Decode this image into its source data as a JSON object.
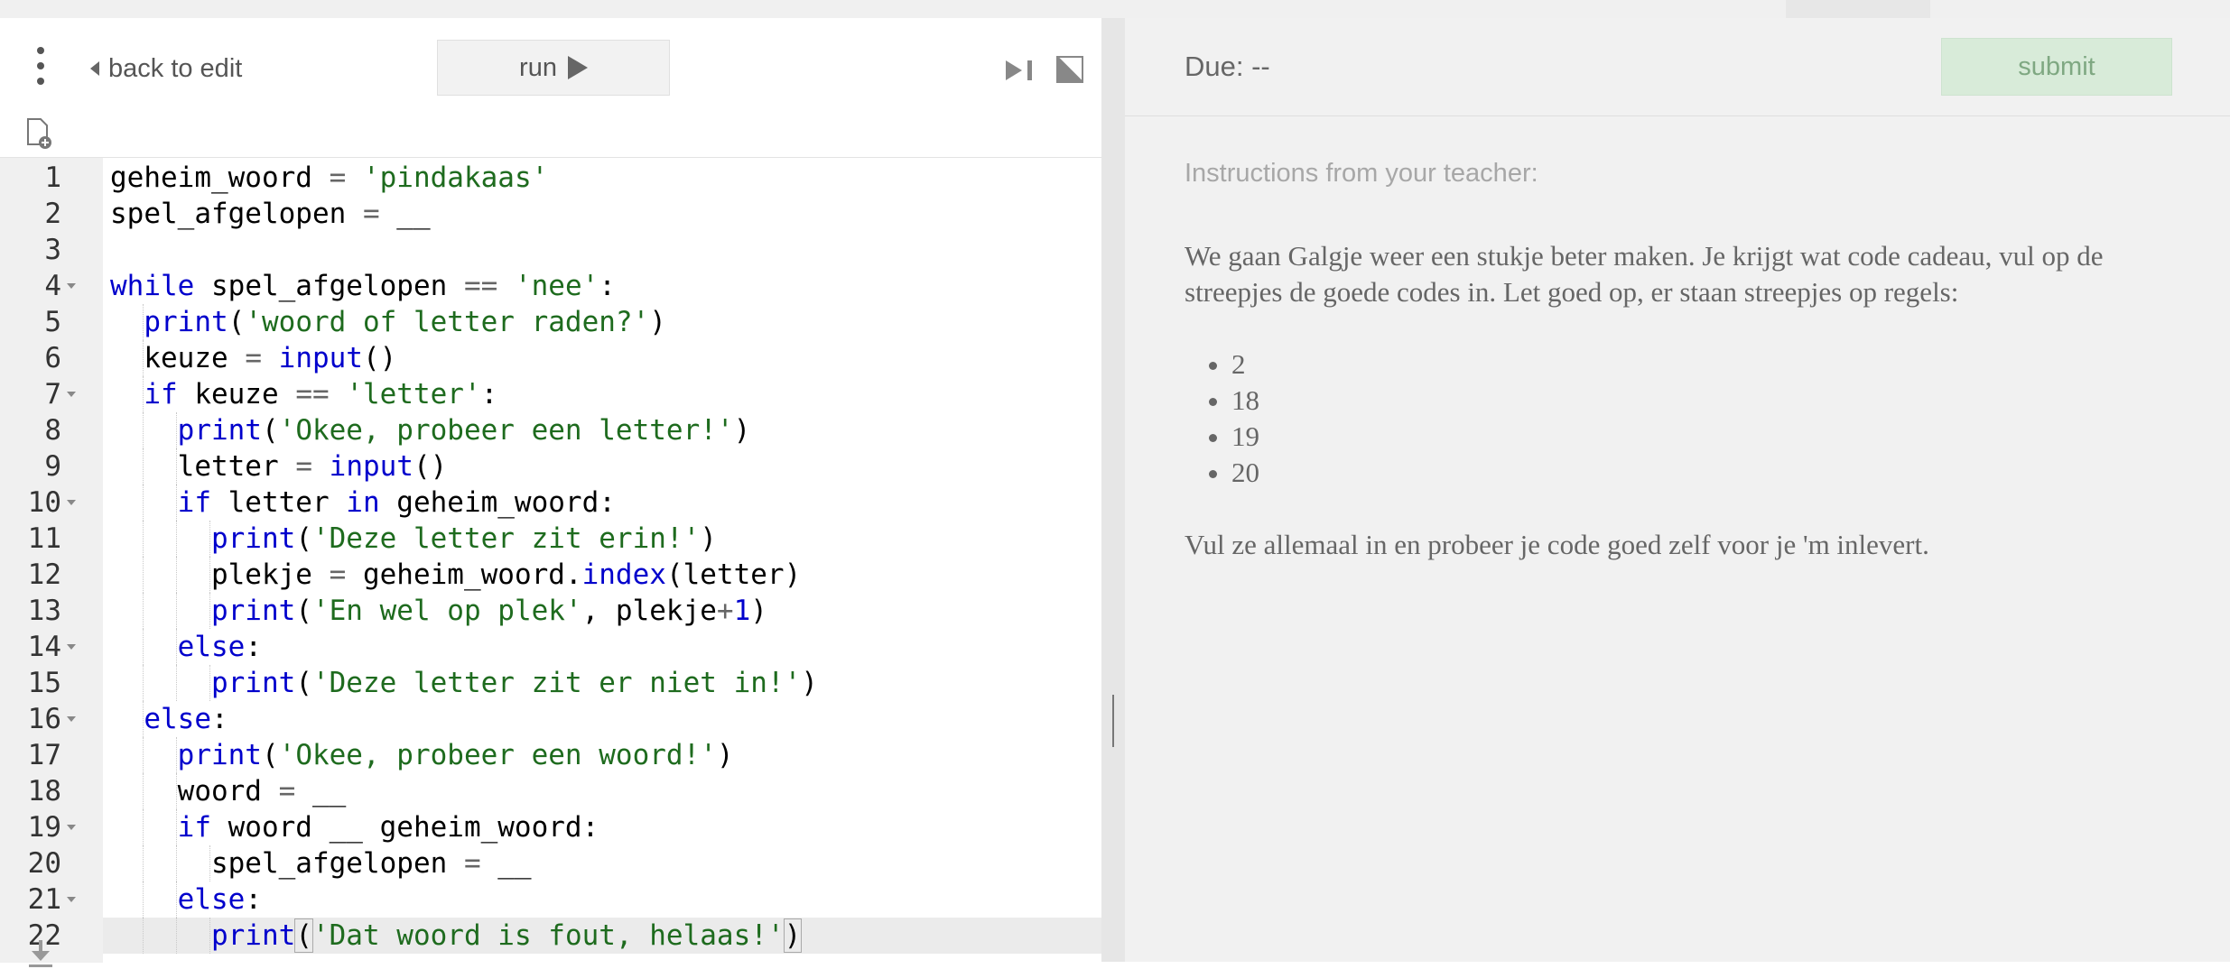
{
  "editor": {
    "back_label": "back to edit",
    "run_label": "run",
    "line_numbers": [
      "1",
      "2",
      "3",
      "4",
      "5",
      "6",
      "7",
      "8",
      "9",
      "10",
      "11",
      "12",
      "13",
      "14",
      "15",
      "16",
      "17",
      "18",
      "19",
      "20",
      "21",
      "22"
    ],
    "folds": [
      4,
      7,
      10,
      14,
      16,
      19,
      21
    ],
    "lines": [
      "<span>geheim_woord</span> <span class=\"op\">=</span> <span class=\"str\">'pindakaas'</span>",
      "<span>spel_afgelopen</span> <span class=\"op\">=</span> __",
      "",
      "<span class=\"kw\">while</span> spel_afgelopen <span class=\"op\">==</span> <span class=\"str\">'nee'</span>:",
      "  <span class=\"kw\">print</span>(<span class=\"str\">'woord of letter raden?'</span>)",
      "  keuze <span class=\"op\">=</span> <span class=\"kw\">input</span>()",
      "  <span class=\"kw\">if</span> keuze <span class=\"op\">==</span> <span class=\"str\">'letter'</span>:",
      "    <span class=\"kw\">print</span>(<span class=\"str\">'Okee, probeer een letter!'</span>)",
      "    letter <span class=\"op\">=</span> <span class=\"kw\">input</span>()",
      "    <span class=\"kw\">if</span> letter <span class=\"kw\">in</span> geheim_woord:",
      "      <span class=\"kw\">print</span>(<span class=\"str\">'Deze letter zit erin!'</span>)",
      "      plekje <span class=\"op\">=</span> geheim_woord.<span class=\"kw\">index</span>(letter)",
      "      <span class=\"kw\">print</span>(<span class=\"str\">'En wel op plek'</span>, plekje<span class=\"op\">+</span><span class=\"kw\">1</span>)",
      "    <span class=\"kw\">else</span>:",
      "      <span class=\"kw\">print</span>(<span class=\"str\">'Deze letter zit er niet in!'</span>)",
      "  <span class=\"kw\">else</span>:",
      "    <span class=\"kw\">print</span>(<span class=\"str\">'Okee, probeer een woord!'</span>)",
      "    woord <span class=\"op\">=</span> __",
      "    <span class=\"kw\">if</span> woord __ geheim_woord:",
      "      spel_afgelopen <span class=\"op\">=</span> __",
      "    <span class=\"kw\">else</span>:",
      "      <span class=\"kw\">print</span><span class=\"br\">(</span><span class=\"str\">'Dat woord is fout, helaas!'</span><span class=\"br\">)</span>"
    ],
    "active_line": 22
  },
  "assignment": {
    "due_label": "Due: --",
    "submit_label": "submit",
    "instructions_heading": "Instructions from your teacher:",
    "intro": "We gaan Galgje weer een stukje beter maken. Je krijgt wat code cadeau, vul op de streepjes de goede codes in. Let goed op, er staan streepjes op regels:",
    "lines_to_fill": [
      "2",
      "18",
      "19",
      "20"
    ],
    "outro": "Vul ze allemaal in en probeer je code goed zelf voor je 'm inlevert."
  },
  "icons": [
    "more-vert-icon",
    "caret-left-icon",
    "play-icon",
    "step-icon",
    "fullscreen-icon",
    "new-file-icon",
    "download-icon"
  ],
  "colors": {
    "keyword": "#0000cc",
    "string": "#1e6b1e",
    "submit_bg": "#d8ebd9",
    "panel_bg": "#f1f1f1"
  }
}
